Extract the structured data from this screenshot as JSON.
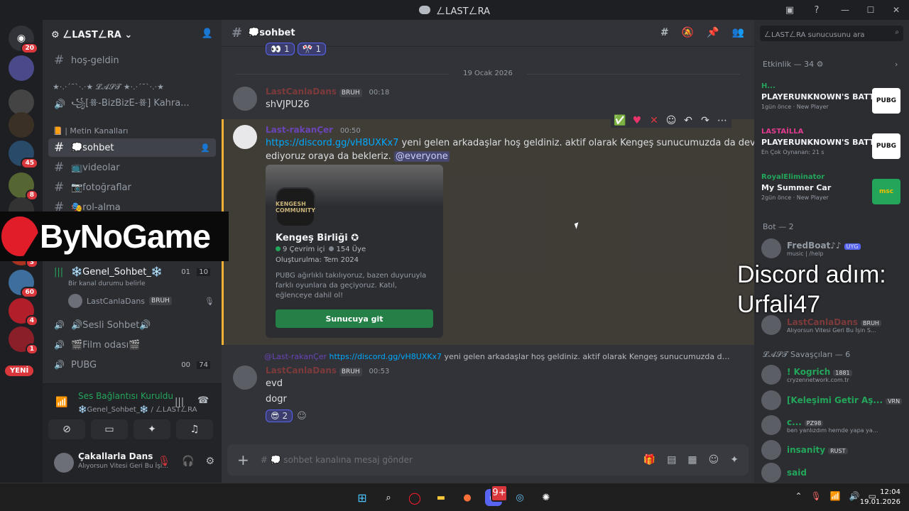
{
  "window": {
    "title": "ㄥLASTㄥRA",
    "controls": [
      "—",
      "☐",
      "✕"
    ]
  },
  "rail": {
    "dm_badge": "20",
    "new_label": "YENİ",
    "servers": [
      {
        "name": "server-1",
        "color": "#4a4a8a",
        "badge": ""
      },
      {
        "name": "server-2",
        "color": "#444",
        "badge": ""
      },
      {
        "name": "server-kengesh",
        "color": "#3a3025",
        "badge": ""
      },
      {
        "name": "server-4",
        "color": "#2a4a6a",
        "badge": "45"
      },
      {
        "name": "server-5",
        "color": "#556633",
        "badge": "8"
      },
      {
        "name": "server-6",
        "color": "#333",
        "badge": ""
      },
      {
        "name": "server-7",
        "color": "#aa3322",
        "badge": "3"
      },
      {
        "name": "server-8",
        "color": "#3d6e9e",
        "badge": "60"
      },
      {
        "name": "server-9",
        "color": "#b21f2a",
        "badge": "4"
      },
      {
        "name": "server-10",
        "color": "#8a1f2a",
        "badge": "1"
      }
    ]
  },
  "sidebar": {
    "guild_name": "ㄥLASTㄥRA",
    "channels_top": [
      {
        "label": "hoş-geldin"
      }
    ],
    "fancy_category": "★·.·´¯`·.·★ 𝓛𝓐𝓢𝓣 ★·.·´¯`·.·★",
    "fancy_voice": "꧁[ꗥ-BizBizE-ꗥ] Kahra...",
    "metin_category": "📙 | Metin Kanalları",
    "text_channels": [
      {
        "label": "💭sohbet",
        "active": true
      },
      {
        "label": "📺videolar",
        "active": false
      },
      {
        "label": "📷fotoğraflar",
        "active": false
      },
      {
        "label": "🎭rol-alma",
        "active": false
      }
    ],
    "voice_active": {
      "label": "❄️Genel_Sohbet_❄️",
      "count": "01",
      "limit": "10",
      "status": "Bir kanal durumu belirle",
      "member": "LastCanlaDans",
      "member_tag": "BRUH"
    },
    "voice_channels": [
      {
        "label": "🔊Sesli Sohbet🔊",
        "count": "",
        "limit": ""
      },
      {
        "label": "🎬Film odası🎬",
        "count": "",
        "limit": ""
      },
      {
        "label": "PUBG",
        "count": "00",
        "limit": "74"
      },
      {
        "label": "Valorant",
        "count": "00",
        "limit": "00"
      }
    ],
    "voice_panel": {
      "title": "Ses Bağlantısı Kuruldu",
      "sub": "❄️Genel_Sohbet_❄️ / ㄥLASTㄥRA"
    },
    "user": {
      "name": "Çakallarla Dans",
      "status": "Alıyorsun Vitesi Geri Bu İşi..."
    }
  },
  "chat": {
    "channel": "💭sohbet",
    "date_divider": "19 Ocak 2026",
    "top_reactions": [
      "1",
      "1"
    ],
    "messages": [
      {
        "author": "LastCanlaDans",
        "tag": "BRUH",
        "time": "00:18",
        "text": "shVJPU26"
      },
      {
        "author": "Last-rakanÇer",
        "time": "00:50",
        "link": "https://discord.gg/vH8UXKx7",
        "text1": " yeni gelen arkadaşlar hoş geldiniz. aktif olarak Kengeş sunucumuzda da devam",
        "text2": "ediyoruz oraya da bekleriz. ",
        "mention": "@everyone"
      },
      {
        "author": "LastCanlaDans",
        "tag": "BRUH",
        "time": "00:53",
        "line1": "evd",
        "line2": "dogr",
        "reaction_count": "2"
      }
    ],
    "reply_preview": {
      "author": "@Last-rakanÇer",
      "link": "https://discord.gg/vH8UXKx7",
      "text": " yeni gelen arkadaşlar hoş geldiniz. aktif olarak Kengeş sunucumuzda da devam ..."
    },
    "embed": {
      "icon_text": "KENGESH COMMUNITY",
      "name": "Kengeş Birliği",
      "online": "9 Çevrim içi",
      "members": "154 Üye",
      "created": "Oluşturulma: Tem 2024",
      "description": "PUBG ağırlıklı takılıyoruz, bazen duyuruyla farklı oyunlara da geçiyoruz. Katıl, eğlenceye dahil ol!",
      "button": "Sunucuya git"
    },
    "composer_placeholder": "# 💭 sohbet kanalına mesaj gönder"
  },
  "right": {
    "search_placeholder": "ㄥLASTㄥRA sunucusunu ara",
    "activity_header": "Etkinlik — 34",
    "activities": [
      {
        "user": "H...",
        "user_color": "#23a55a",
        "game": "PLAYERUNKNOWN'S BATT...",
        "meta": "1gün önce · New Player",
        "thumb": "PUBG"
      },
      {
        "user": "LASTAİLLA",
        "user_color": "#e13b8e",
        "game": "PLAYERUNKNOWN'S BATT...",
        "meta": "En Çok Oynanan: 21 s",
        "thumb": "PUBG"
      },
      {
        "user": "RoyalEliminator",
        "user_color": "#23a55a",
        "game": "My Summer Car",
        "meta": "2gün önce · New Player",
        "thumb": "msc"
      }
    ],
    "bot_header": "Bot — 2",
    "bots": [
      {
        "name": "FredBoat♪♪",
        "tag": "UYG",
        "status": "music | /help",
        "color": "#949ba4"
      }
    ],
    "partial_member": {
      "name": "LastCanlaDans",
      "tag": "BRUH",
      "status": "Alıyorsun Vitesi Geri Bu İşin S..."
    },
    "group_header": "𝓛𝓐𝓢𝓣 Savaşçıları — 6",
    "members": [
      {
        "name": "! Kogrich",
        "tag": "1881",
        "status": "cryzennetwork.com.tr",
        "color": "#23a55a"
      },
      {
        "name": "[Keleşimi Getir Aş...",
        "tag": "VRN",
        "status": "",
        "color": "#23a55a"
      },
      {
        "name": "c...",
        "tag": "PZ98",
        "status": "ben yanlızdım hemde yapa ya...",
        "color": "#23a55a"
      },
      {
        "name": "insanity",
        "tag": "RUST",
        "status": "",
        "color": "#23a55a"
      },
      {
        "name": "said",
        "tag": "",
        "status": "",
        "color": "#23a55a"
      }
    ]
  },
  "overlay": {
    "brand": "ByNoGame",
    "caption_line1": "Discord adım:",
    "caption_line2": "Urfali47"
  },
  "taskbar": {
    "time": "12:04",
    "date": "19.01.2026",
    "discord_badge": "9+"
  }
}
